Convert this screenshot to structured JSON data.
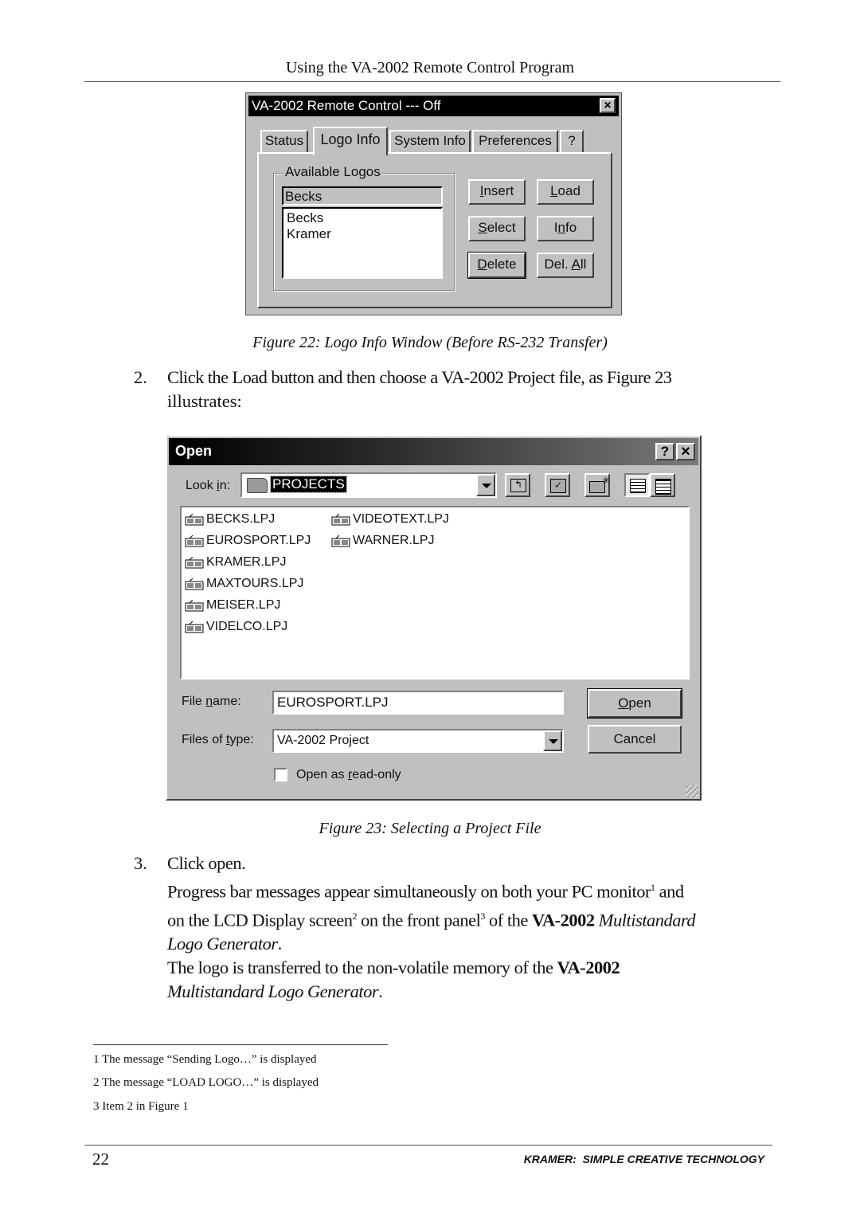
{
  "header": {
    "title": "Using the VA-2002 Remote Control Program"
  },
  "figure22": {
    "window_title": "VA-2002 Remote Control --- Off",
    "close_glyph": "×",
    "tabs": [
      {
        "label": "Status",
        "active": false
      },
      {
        "label": "Logo Info",
        "active": true
      },
      {
        "label": "System Info",
        "active": false
      },
      {
        "label": "Preferences",
        "active": false
      },
      {
        "label": "?",
        "active": false
      }
    ],
    "group_label": "Available Logos",
    "selected_logo": "Becks",
    "logo_list": [
      "Becks",
      "Kramer"
    ],
    "buttons": {
      "insert": {
        "pre": "",
        "ul": "I",
        "post": "nsert"
      },
      "load": {
        "pre": "",
        "ul": "L",
        "post": "oad"
      },
      "select": {
        "pre": "",
        "ul": "S",
        "post": "elect"
      },
      "info": {
        "pre": "I",
        "ul": "n",
        "post": "fo"
      },
      "delete": {
        "pre": "",
        "ul": "D",
        "post": "elete"
      },
      "del_all": {
        "pre": "Del. ",
        "ul": "A",
        "post": "ll"
      }
    },
    "caption": "Figure 22: Logo Info Window (Before RS-232 Transfer)"
  },
  "step2": {
    "number": "2.",
    "text_line1": "Click the Load button and then choose a VA-2002 Project file, as Figure 23",
    "text_line2": "illustrates:"
  },
  "figure23": {
    "window_title": "Open",
    "help_glyph": "?",
    "close_glyph": "×",
    "look_in_label": {
      "pre": "Look ",
      "ul": "i",
      "post": "n:"
    },
    "look_in_value": "PROJECTS",
    "toolbar": [
      "up-one-level",
      "desktop",
      "create-new-folder",
      "list-view",
      "details-view"
    ],
    "files_col1": [
      "BECKS.LPJ",
      "EUROSPORT.LPJ",
      "KRAMER.LPJ",
      "MAXTOURS.LPJ",
      "MEISER.LPJ",
      "VIDELCO.LPJ"
    ],
    "files_col2": [
      "VIDEOTEXT.LPJ",
      "WARNER.LPJ"
    ],
    "file_name_label": {
      "pre": "File ",
      "ul": "n",
      "post": "ame:"
    },
    "file_name_value": "EUROSPORT.LPJ",
    "files_of_type_label": {
      "pre": "Files of ",
      "ul": "t",
      "post": "ype:"
    },
    "files_of_type_value": "VA-2002 Project",
    "open_button": {
      "pre": "",
      "ul": "O",
      "post": "pen"
    },
    "cancel_button": "Cancel",
    "readonly_label": {
      "pre": "Open as ",
      "ul": "r",
      "post": "ead-only"
    },
    "readonly_checked": false,
    "caption": "Figure 23: Selecting a Project File"
  },
  "step3": {
    "number": "3.",
    "line1": "Click open.",
    "line2a": "Progress bar messages appear simultaneously on both your PC monitor",
    "sup1": "1",
    "line2b": " and",
    "line3a": "on the LCD Display screen",
    "sup2": "2",
    "line3b": " on the front panel",
    "sup3": "3",
    "line3c": " of the ",
    "product_bold": "VA-2002",
    "product_italic": " Multistandard",
    "line4": "Logo Generator",
    "line4end": ".",
    "line5a": "The logo is transferred to the non-volatile memory of the ",
    "line5b": "VA-2002",
    "line6": "Multistandard Logo Generator",
    "line6end": "."
  },
  "footnotes": [
    "1 The message “Sending Logo…” is displayed",
    "2 The message “LOAD LOGO…” is displayed",
    "3 Item 2 in Figure 1"
  ],
  "footer": {
    "page_number": "22",
    "tagline": "KRAMER:  SIMPLE CREATIVE TECHNOLOGY"
  }
}
